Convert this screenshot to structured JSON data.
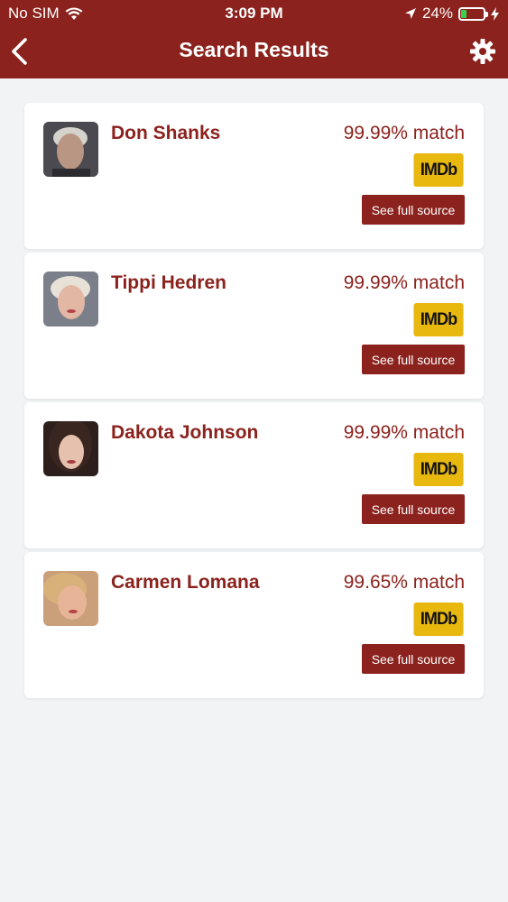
{
  "status_bar": {
    "carrier": "No SIM",
    "time": "3:09 PM",
    "battery": "24%",
    "battery_level": 0.24
  },
  "header": {
    "title": "Search Results",
    "back_icon": "chevron-left-icon",
    "settings_icon": "gear-icon"
  },
  "colors": {
    "brand": "#8b221d",
    "imdb_yellow": "#e8b80e",
    "background": "#f2f3f5"
  },
  "results": [
    {
      "name": "Don Shanks",
      "match": "99.99% match",
      "badge": "IMDb",
      "button": "See full source",
      "avatar_tone": "#b99584",
      "hair": "#d6d2cc"
    },
    {
      "name": "Tippi Hedren",
      "match": "99.99% match",
      "badge": "IMDb",
      "button": "See full source",
      "avatar_tone": "#e2b7a4",
      "hair": "#e8e1d8"
    },
    {
      "name": "Dakota Johnson",
      "match": "99.99% match",
      "badge": "IMDb",
      "button": "See full source",
      "avatar_tone": "#e6c2ae",
      "hair": "#3a2620"
    },
    {
      "name": "Carmen Lomana",
      "match": "99.65% match",
      "badge": "IMDb",
      "button": "See full source",
      "avatar_tone": "#e7b497",
      "hair": "#d8b07a"
    }
  ]
}
